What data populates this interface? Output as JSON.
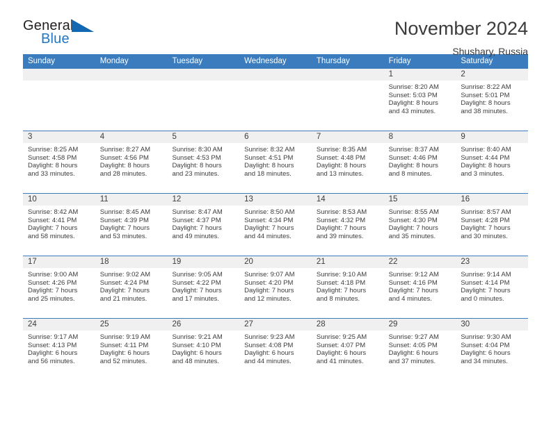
{
  "logo": {
    "word_one": "General",
    "word_two": "Blue",
    "triangle": "triangle-mark"
  },
  "header": {
    "title": "November 2024",
    "subtitle": "Shushary, Russia"
  },
  "colors": {
    "header_blue": "#3a7cbe",
    "logo_blue": "#1268b3",
    "day_band_gray": "#f0f0f0",
    "text": "#3c3c3c"
  },
  "weekdays": [
    "Sunday",
    "Monday",
    "Tuesday",
    "Wednesday",
    "Thursday",
    "Friday",
    "Saturday"
  ],
  "weeks": [
    [
      {
        "day": "",
        "empty": true
      },
      {
        "day": "",
        "empty": true
      },
      {
        "day": "",
        "empty": true
      },
      {
        "day": "",
        "empty": true
      },
      {
        "day": "",
        "empty": true
      },
      {
        "day": "1",
        "sunrise": "Sunrise: 8:20 AM",
        "sunset": "Sunset: 5:03 PM",
        "daylight_1": "Daylight: 8 hours",
        "daylight_2": "and 43 minutes."
      },
      {
        "day": "2",
        "sunrise": "Sunrise: 8:22 AM",
        "sunset": "Sunset: 5:01 PM",
        "daylight_1": "Daylight: 8 hours",
        "daylight_2": "and 38 minutes."
      }
    ],
    [
      {
        "day": "3",
        "sunrise": "Sunrise: 8:25 AM",
        "sunset": "Sunset: 4:58 PM",
        "daylight_1": "Daylight: 8 hours",
        "daylight_2": "and 33 minutes."
      },
      {
        "day": "4",
        "sunrise": "Sunrise: 8:27 AM",
        "sunset": "Sunset: 4:56 PM",
        "daylight_1": "Daylight: 8 hours",
        "daylight_2": "and 28 minutes."
      },
      {
        "day": "5",
        "sunrise": "Sunrise: 8:30 AM",
        "sunset": "Sunset: 4:53 PM",
        "daylight_1": "Daylight: 8 hours",
        "daylight_2": "and 23 minutes."
      },
      {
        "day": "6",
        "sunrise": "Sunrise: 8:32 AM",
        "sunset": "Sunset: 4:51 PM",
        "daylight_1": "Daylight: 8 hours",
        "daylight_2": "and 18 minutes."
      },
      {
        "day": "7",
        "sunrise": "Sunrise: 8:35 AM",
        "sunset": "Sunset: 4:48 PM",
        "daylight_1": "Daylight: 8 hours",
        "daylight_2": "and 13 minutes."
      },
      {
        "day": "8",
        "sunrise": "Sunrise: 8:37 AM",
        "sunset": "Sunset: 4:46 PM",
        "daylight_1": "Daylight: 8 hours",
        "daylight_2": "and 8 minutes."
      },
      {
        "day": "9",
        "sunrise": "Sunrise: 8:40 AM",
        "sunset": "Sunset: 4:44 PM",
        "daylight_1": "Daylight: 8 hours",
        "daylight_2": "and 3 minutes."
      }
    ],
    [
      {
        "day": "10",
        "sunrise": "Sunrise: 8:42 AM",
        "sunset": "Sunset: 4:41 PM",
        "daylight_1": "Daylight: 7 hours",
        "daylight_2": "and 58 minutes."
      },
      {
        "day": "11",
        "sunrise": "Sunrise: 8:45 AM",
        "sunset": "Sunset: 4:39 PM",
        "daylight_1": "Daylight: 7 hours",
        "daylight_2": "and 53 minutes."
      },
      {
        "day": "12",
        "sunrise": "Sunrise: 8:47 AM",
        "sunset": "Sunset: 4:37 PM",
        "daylight_1": "Daylight: 7 hours",
        "daylight_2": "and 49 minutes."
      },
      {
        "day": "13",
        "sunrise": "Sunrise: 8:50 AM",
        "sunset": "Sunset: 4:34 PM",
        "daylight_1": "Daylight: 7 hours",
        "daylight_2": "and 44 minutes."
      },
      {
        "day": "14",
        "sunrise": "Sunrise: 8:53 AM",
        "sunset": "Sunset: 4:32 PM",
        "daylight_1": "Daylight: 7 hours",
        "daylight_2": "and 39 minutes."
      },
      {
        "day": "15",
        "sunrise": "Sunrise: 8:55 AM",
        "sunset": "Sunset: 4:30 PM",
        "daylight_1": "Daylight: 7 hours",
        "daylight_2": "and 35 minutes."
      },
      {
        "day": "16",
        "sunrise": "Sunrise: 8:57 AM",
        "sunset": "Sunset: 4:28 PM",
        "daylight_1": "Daylight: 7 hours",
        "daylight_2": "and 30 minutes."
      }
    ],
    [
      {
        "day": "17",
        "sunrise": "Sunrise: 9:00 AM",
        "sunset": "Sunset: 4:26 PM",
        "daylight_1": "Daylight: 7 hours",
        "daylight_2": "and 25 minutes."
      },
      {
        "day": "18",
        "sunrise": "Sunrise: 9:02 AM",
        "sunset": "Sunset: 4:24 PM",
        "daylight_1": "Daylight: 7 hours",
        "daylight_2": "and 21 minutes."
      },
      {
        "day": "19",
        "sunrise": "Sunrise: 9:05 AM",
        "sunset": "Sunset: 4:22 PM",
        "daylight_1": "Daylight: 7 hours",
        "daylight_2": "and 17 minutes."
      },
      {
        "day": "20",
        "sunrise": "Sunrise: 9:07 AM",
        "sunset": "Sunset: 4:20 PM",
        "daylight_1": "Daylight: 7 hours",
        "daylight_2": "and 12 minutes."
      },
      {
        "day": "21",
        "sunrise": "Sunrise: 9:10 AM",
        "sunset": "Sunset: 4:18 PM",
        "daylight_1": "Daylight: 7 hours",
        "daylight_2": "and 8 minutes."
      },
      {
        "day": "22",
        "sunrise": "Sunrise: 9:12 AM",
        "sunset": "Sunset: 4:16 PM",
        "daylight_1": "Daylight: 7 hours",
        "daylight_2": "and 4 minutes."
      },
      {
        "day": "23",
        "sunrise": "Sunrise: 9:14 AM",
        "sunset": "Sunset: 4:14 PM",
        "daylight_1": "Daylight: 7 hours",
        "daylight_2": "and 0 minutes."
      }
    ],
    [
      {
        "day": "24",
        "sunrise": "Sunrise: 9:17 AM",
        "sunset": "Sunset: 4:13 PM",
        "daylight_1": "Daylight: 6 hours",
        "daylight_2": "and 56 minutes."
      },
      {
        "day": "25",
        "sunrise": "Sunrise: 9:19 AM",
        "sunset": "Sunset: 4:11 PM",
        "daylight_1": "Daylight: 6 hours",
        "daylight_2": "and 52 minutes."
      },
      {
        "day": "26",
        "sunrise": "Sunrise: 9:21 AM",
        "sunset": "Sunset: 4:10 PM",
        "daylight_1": "Daylight: 6 hours",
        "daylight_2": "and 48 minutes."
      },
      {
        "day": "27",
        "sunrise": "Sunrise: 9:23 AM",
        "sunset": "Sunset: 4:08 PM",
        "daylight_1": "Daylight: 6 hours",
        "daylight_2": "and 44 minutes."
      },
      {
        "day": "28",
        "sunrise": "Sunrise: 9:25 AM",
        "sunset": "Sunset: 4:07 PM",
        "daylight_1": "Daylight: 6 hours",
        "daylight_2": "and 41 minutes."
      },
      {
        "day": "29",
        "sunrise": "Sunrise: 9:27 AM",
        "sunset": "Sunset: 4:05 PM",
        "daylight_1": "Daylight: 6 hours",
        "daylight_2": "and 37 minutes."
      },
      {
        "day": "30",
        "sunrise": "Sunrise: 9:30 AM",
        "sunset": "Sunset: 4:04 PM",
        "daylight_1": "Daylight: 6 hours",
        "daylight_2": "and 34 minutes."
      }
    ]
  ]
}
